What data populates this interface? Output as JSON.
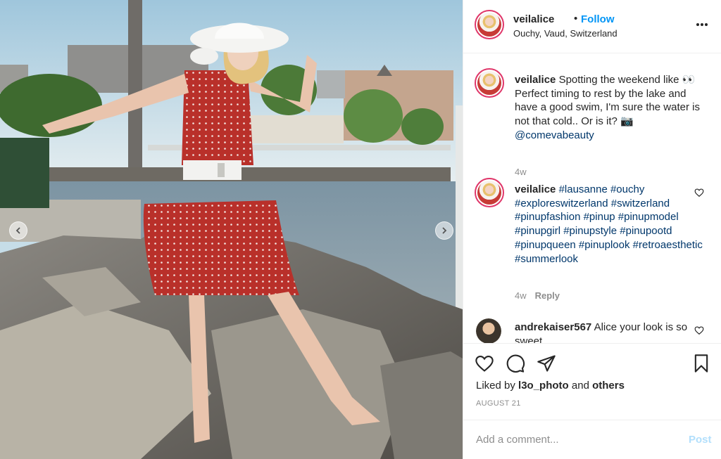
{
  "post": {
    "username": "veilalice",
    "follow_label": "Follow",
    "separator": "•",
    "location": "Ouchy, Vaud, Switzerland",
    "more_icon": "more-dots-icon"
  },
  "comments": [
    {
      "username": "veilalice",
      "parts": [
        {
          "text": "Spotting the weekend like 👀 Perfect timing to rest by the lake and have a good swim, I'm sure the water is not that cold.. Or is it? 📷 ",
          "type": "plain"
        },
        {
          "text": "@comevabeauty",
          "type": "tag"
        }
      ],
      "time": "4w"
    },
    {
      "username": "veilalice",
      "parts": [
        {
          "text": "#lausanne #ouchy #exploreswitzerland #switzerland #pinupfashion #pinup #pinupmodel #pinupgirl #pinupstyle #pinupootd #pinupqueen #pinuplook #retroaesthetic #summerlook",
          "type": "tag"
        }
      ],
      "time": "4w",
      "reply_label": "Reply"
    },
    {
      "username": "andrekaiser567",
      "parts": [
        {
          "text": "Alice your look is so sweet",
          "type": "plain"
        }
      ]
    }
  ],
  "likes": {
    "prefix": "Liked by",
    "user": "l3o_photo",
    "middle": "and",
    "others": "others"
  },
  "date": "AUGUST 21",
  "comment_box": {
    "placeholder": "Add a comment...",
    "post_label": "Post"
  },
  "colors": {
    "accent": "#0095f6",
    "post_disabled": "#b2dffc",
    "tag": "#00376b",
    "muted": "#8e8e8e"
  }
}
